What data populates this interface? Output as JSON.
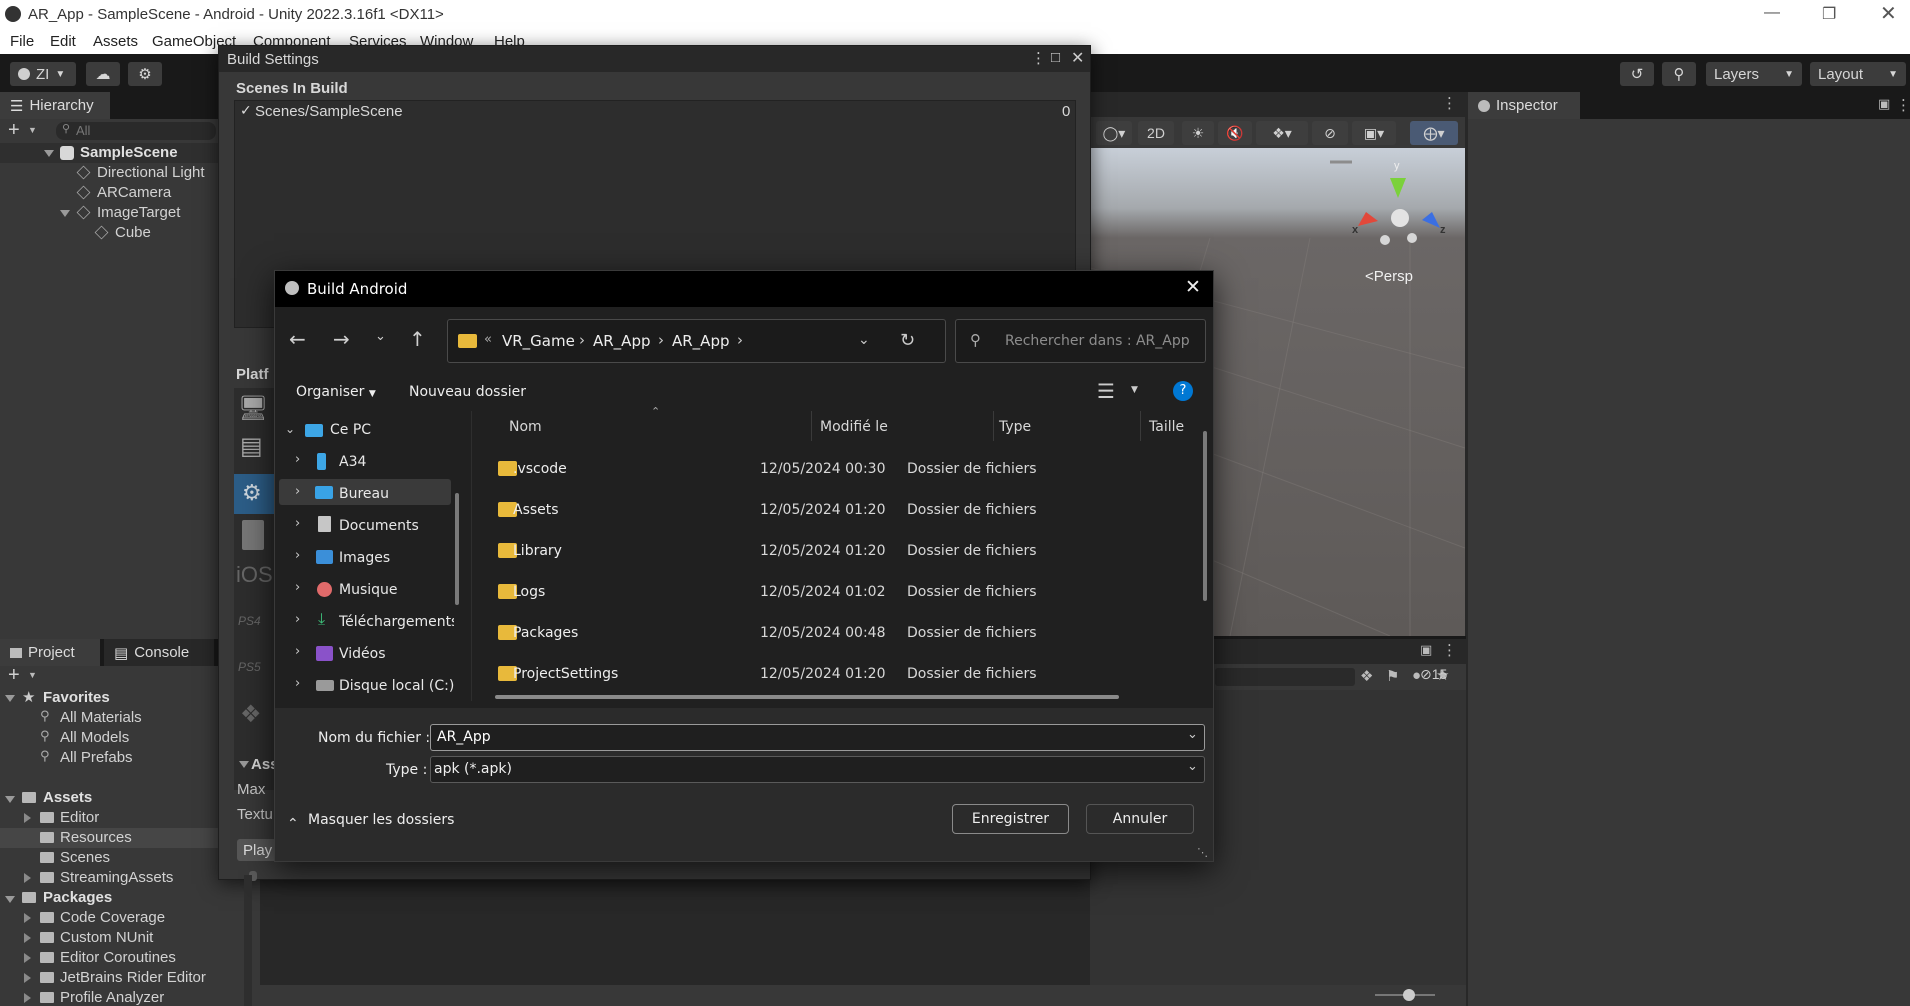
{
  "window": {
    "title": "AR_App - SampleScene - Android - Unity 2022.3.16f1 <DX11>"
  },
  "menu": [
    "File",
    "Edit",
    "Assets",
    "GameObject",
    "Component",
    "Services",
    "Window",
    "Help"
  ],
  "toolbar": {
    "account_label": "ZI",
    "layers_label": "Layers",
    "layout_label": "Layout"
  },
  "hierarchy": {
    "tab_label": "Hierarchy",
    "search_placeholder": "All",
    "scene": "SampleScene",
    "items": [
      "Directional Light",
      "ARCamera",
      "ImageTarget",
      "Cube"
    ]
  },
  "inspector": {
    "tab_label": "Inspector"
  },
  "scene_view": {
    "mode_2d": "2D",
    "persp_label": "<Persp",
    "axis_x": "x",
    "axis_y": "y",
    "axis_z": "z",
    "hidden_count": "15"
  },
  "project": {
    "tab_project": "Project",
    "tab_console": "Console",
    "favorites_label": "Favorites",
    "favorites": [
      "All Materials",
      "All Models",
      "All Prefabs"
    ],
    "assets_label": "Assets",
    "assets": [
      "Editor",
      "Resources",
      "Scenes",
      "StreamingAssets"
    ],
    "packages_label": "Packages",
    "packages": [
      "Code Coverage",
      "Custom NUnit",
      "Editor Coroutines",
      "JetBrains Rider Editor",
      "Profile Analyzer"
    ]
  },
  "build_settings": {
    "title": "Build Settings",
    "scenes_header": "Scenes In Build",
    "scene_entry": "Scenes/SampleScene",
    "scene_index": "0",
    "platform_label": "Platf",
    "ios_label": "iOS",
    "asset_label": "Ass",
    "max_label": "Max",
    "textu_label": "Textu",
    "play_label": "Play"
  },
  "dialog": {
    "title": "Build Android",
    "breadcrumb_prefix": "«",
    "breadcrumb": [
      "VR_Game",
      "AR_App",
      "AR_App"
    ],
    "search_placeholder": "Rechercher dans : AR_App",
    "organize_label": "Organiser",
    "new_folder_label": "Nouveau dossier",
    "columns": {
      "name": "Nom",
      "modified": "Modifié le",
      "type": "Type",
      "size": "Taille"
    },
    "nav": [
      {
        "label": "Ce PC",
        "icon": "computer-icon"
      },
      {
        "label": "A34",
        "icon": "phone-icon"
      },
      {
        "label": "Bureau",
        "icon": "desktop-icon"
      },
      {
        "label": "Documents",
        "icon": "document-icon"
      },
      {
        "label": "Images",
        "icon": "image-icon"
      },
      {
        "label": "Musique",
        "icon": "music-icon"
      },
      {
        "label": "Téléchargements",
        "icon": "download-icon"
      },
      {
        "label": "Vidéos",
        "icon": "video-icon"
      },
      {
        "label": "Disque local (C:)",
        "icon": "drive-icon"
      }
    ],
    "files": [
      {
        "name": ".vscode",
        "modified": "12/05/2024 00:30",
        "type": "Dossier de fichiers"
      },
      {
        "name": "Assets",
        "modified": "12/05/2024 01:20",
        "type": "Dossier de fichiers"
      },
      {
        "name": "Library",
        "modified": "12/05/2024 01:20",
        "type": "Dossier de fichiers"
      },
      {
        "name": "Logs",
        "modified": "12/05/2024 01:02",
        "type": "Dossier de fichiers"
      },
      {
        "name": "Packages",
        "modified": "12/05/2024 00:48",
        "type": "Dossier de fichiers"
      },
      {
        "name": "ProjectSettings",
        "modified": "12/05/2024 01:20",
        "type": "Dossier de fichiers"
      }
    ],
    "filename_label": "Nom du fichier :",
    "filename_value": "AR_App",
    "type_label": "Type :",
    "type_value": "apk (*.apk)",
    "hide_folders_label": "Masquer les dossiers",
    "save_label": "Enregistrer",
    "cancel_label": "Annuler",
    "accent_color": "#0078d4",
    "folder_color": "#e8b93b"
  }
}
